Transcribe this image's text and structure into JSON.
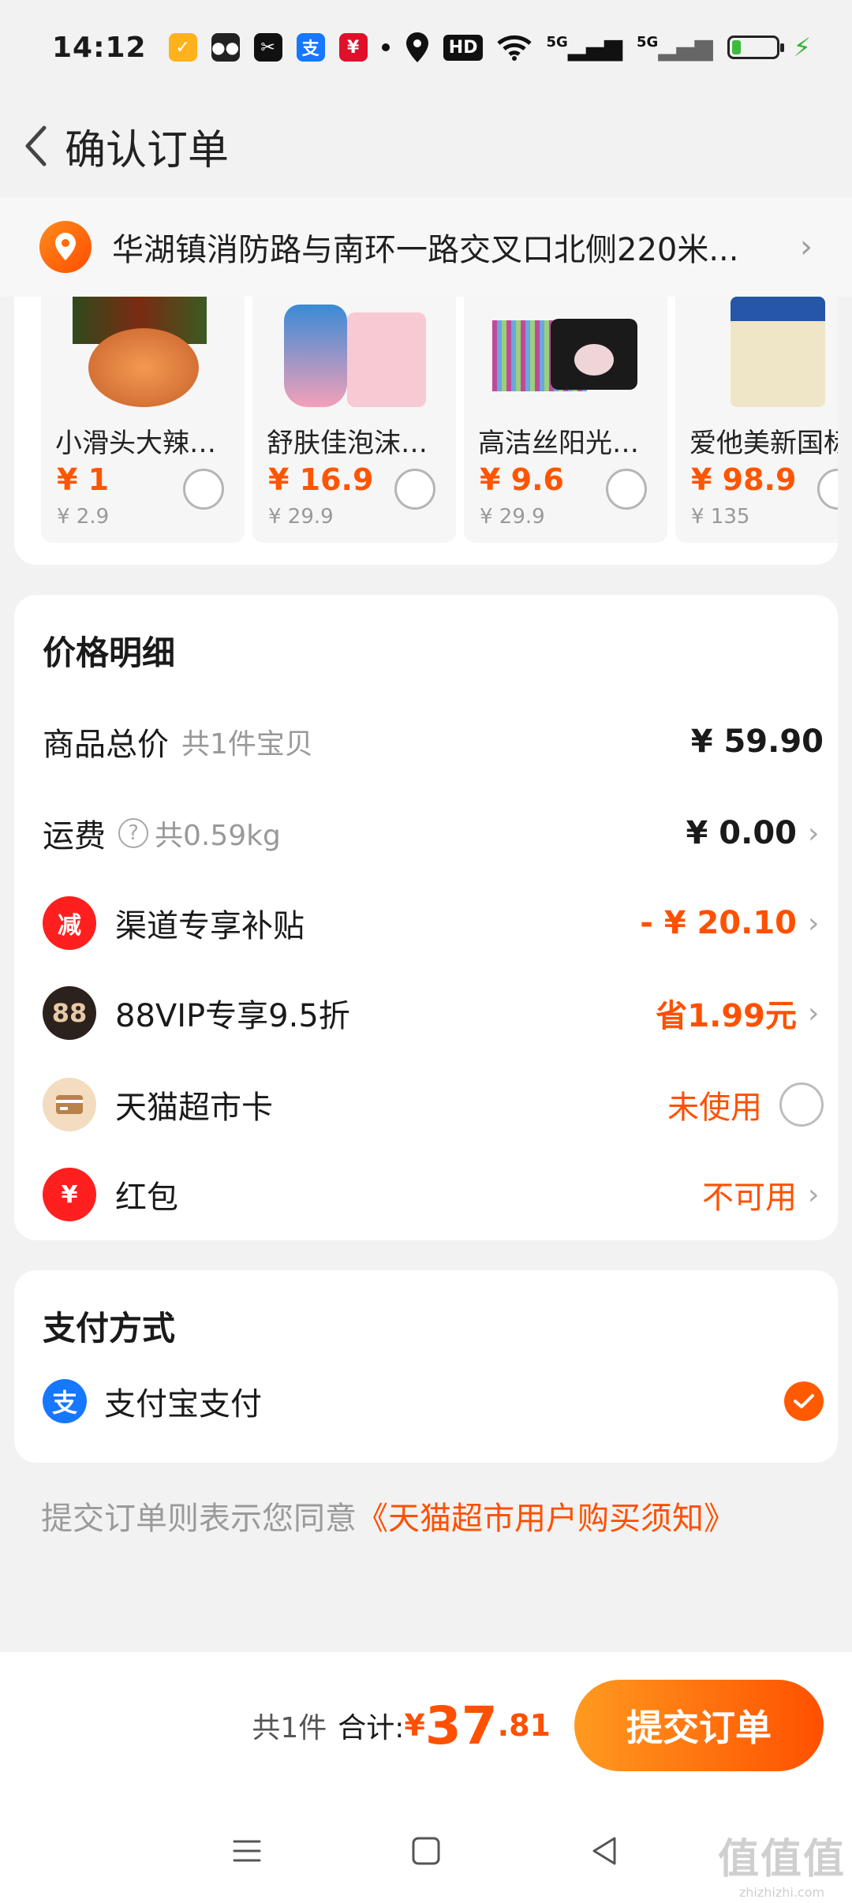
{
  "status_bar": {
    "time": "14:12",
    "network_a": "5G",
    "network_b": "5G",
    "hd_badge": "HD",
    "battery_percent": 22,
    "icons": [
      "wechat-icon",
      "capcut-icon",
      "alipay-icon",
      "bank-icon",
      "location-icon",
      "wifi-icon",
      "signal-icon",
      "battery-icon",
      "charging-icon"
    ]
  },
  "header": {
    "title": "确认订单"
  },
  "address": {
    "text": "华湖镇消防路与南环一路交叉口北侧220米..."
  },
  "products": [
    {
      "name": "小滑头大辣片...",
      "price": "¥ 1",
      "original": "¥ 2.9"
    },
    {
      "name": "舒肤佳泡沫洗...",
      "price": "¥ 16.9",
      "original": "¥ 29.9"
    },
    {
      "name": "高洁丝阳光纯...",
      "price": "¥ 9.6",
      "original": "¥ 29.9"
    },
    {
      "name": "爱他美新国标",
      "price": "¥ 98.9",
      "original": "¥ 135"
    }
  ],
  "price_detail": {
    "title": "价格明细",
    "goods_total_label": "商品总价",
    "goods_count": "共1件宝贝",
    "goods_total": "¥ 59.90",
    "shipping_label": "运费",
    "shipping_weight": "共0.59kg",
    "shipping_amount": "¥ 0.00",
    "subsidy_label": "渠道专享补贴",
    "subsidy_icon_text": "减",
    "subsidy_amount": "- ¥ 20.10",
    "vip_label": "88VIP专享9.5折",
    "vip_icon_text": "88",
    "vip_amount": "省1.99元",
    "card_label": "天猫超市卡",
    "card_status": "未使用",
    "redpacket_label": "红包",
    "redpacket_icon_text": "¥",
    "redpacket_status": "不可用"
  },
  "payment": {
    "title": "支付方式",
    "method_icon_text": "支",
    "method": "支付宝支付"
  },
  "agreement": {
    "prefix": "提交订单则表示您同意",
    "link": "《天猫超市用户购买须知》"
  },
  "bottom": {
    "count": "共1件",
    "total_label": "合计:",
    "currency": "¥",
    "total_int": "37",
    "total_dec": ".81",
    "submit_label": "提交订单"
  },
  "watermark": {
    "big": "值值值",
    "small": "zhizhizhi.com"
  },
  "colors": {
    "accent": "#ff5000",
    "alipay": "#1677ff",
    "background": "#f2f2f2"
  }
}
